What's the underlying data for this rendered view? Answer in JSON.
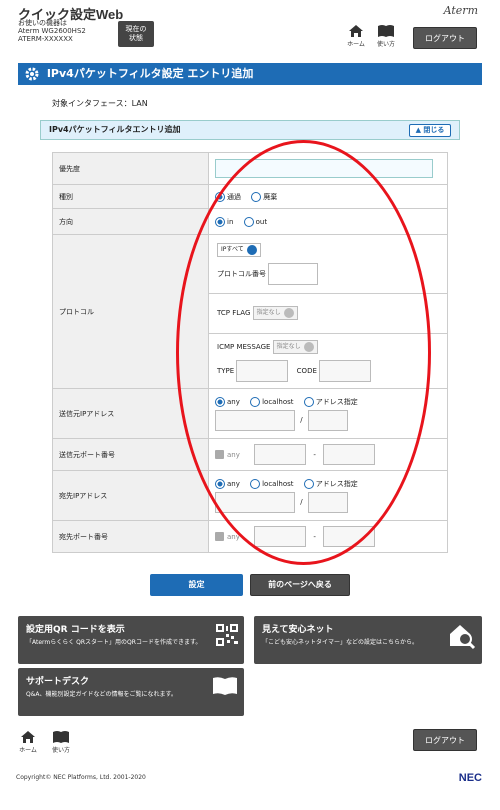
{
  "header": {
    "app_title": "クイック設定Web",
    "device_label": "お使いの機器は",
    "device_model": "Aterm WG2600HS2",
    "device_id": "ATERM-XXXXXX",
    "status_button": [
      "現在の",
      "状態"
    ],
    "brand": "Aterm",
    "home_label": "ホーム",
    "help_label": "使い方",
    "logout_label": "ログアウト"
  },
  "page": {
    "title": "IPv4パケットフィルタ設定 エントリ追加",
    "interface_label": "対象インタフェース：LAN",
    "section_title": "IPv4パケットフィルタエントリ追加",
    "close_label": "閉じる"
  },
  "form": {
    "priority_label": "優先度",
    "priority_value": "",
    "type_label": "種別",
    "type_options": [
      "通過",
      "廃棄"
    ],
    "type_selected": "通過",
    "direction_label": "方向",
    "direction_options": [
      "in",
      "out"
    ],
    "direction_selected": "in",
    "protocol_label": "プロトコル",
    "protocol_select": "IPすべて",
    "protocol_number_label": "プロトコル番号",
    "tcp_flag_label": "TCP FLAG",
    "tcp_flag_select": "指定なし",
    "icmp_label": "ICMP MESSAGE",
    "icmp_select": "指定なし",
    "type_field_label": "TYPE",
    "code_field_label": "CODE",
    "src_ip_label": "送信元IPアドレス",
    "src_port_label": "送信元ポート番号",
    "dst_ip_label": "宛先IPアドレス",
    "dst_port_label": "宛先ポート番号",
    "ip_options": [
      "any",
      "localhost",
      "アドレス指定"
    ],
    "ip_selected": "any",
    "slash": "/",
    "port_any_label": "any",
    "dash": "-"
  },
  "actions": {
    "submit_label": "設定",
    "back_label": "前のページへ戻る"
  },
  "cards": [
    {
      "title": "設定用QR コードを表示",
      "desc": "「Atermらくらく QRスタート」用のQRコードを作成できます。"
    },
    {
      "title": "見えて安心ネット",
      "desc": "「こども安心ネットタイマー」などの設定はこちらから。"
    },
    {
      "title": "サポートデスク",
      "desc": "Q&A、機能別設定ガイドなどの情報をご覧になれます。"
    }
  ],
  "footer": {
    "copyright": "Copyright© NEC Platforms, Ltd. 2001-2020",
    "brand": "NEC"
  },
  "colors": {
    "accent": "#1e6cb5",
    "annotation": "#e8141c"
  }
}
